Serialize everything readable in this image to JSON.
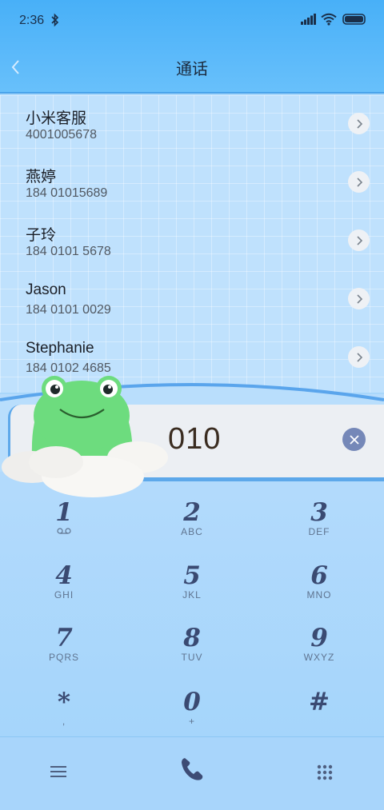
{
  "status_bar": {
    "time": "2:36"
  },
  "header": {
    "title": "通话"
  },
  "contacts": [
    {
      "name": "小米客服",
      "number": "4001005678"
    },
    {
      "name": "燕婷",
      "number": "184 01015689"
    },
    {
      "name": "子玲",
      "number": "184 0101 5678"
    },
    {
      "name": "Jason",
      "number": "184 0101 0029"
    },
    {
      "name": "Stephanie",
      "number": "184 0102 4685"
    }
  ],
  "dial_input": {
    "value": "010"
  },
  "keypad": [
    {
      "digit": "1",
      "letters": ""
    },
    {
      "digit": "2",
      "letters": "ABC"
    },
    {
      "digit": "3",
      "letters": "DEF"
    },
    {
      "digit": "4",
      "letters": "GHI"
    },
    {
      "digit": "5",
      "letters": "JKL"
    },
    {
      "digit": "6",
      "letters": "MNO"
    },
    {
      "digit": "7",
      "letters": "PQRS"
    },
    {
      "digit": "8",
      "letters": "TUV"
    },
    {
      "digit": "9",
      "letters": "WXYZ"
    },
    {
      "digit": "*",
      "letters": ","
    },
    {
      "digit": "0",
      "letters": "+"
    },
    {
      "digit": "#",
      "letters": ""
    }
  ],
  "icons": {
    "back": "chevron-left-icon",
    "detail": "chevron-right-icon",
    "clear": "close-icon",
    "voicemail": "voicemail-icon",
    "menu": "menu-icon",
    "call": "phone-icon",
    "dialpad": "dialpad-icon"
  },
  "colors": {
    "header": "#48b0f8",
    "background": "#a9d7fb",
    "accent": "#3a4a72",
    "clear_button": "#7588b8"
  }
}
